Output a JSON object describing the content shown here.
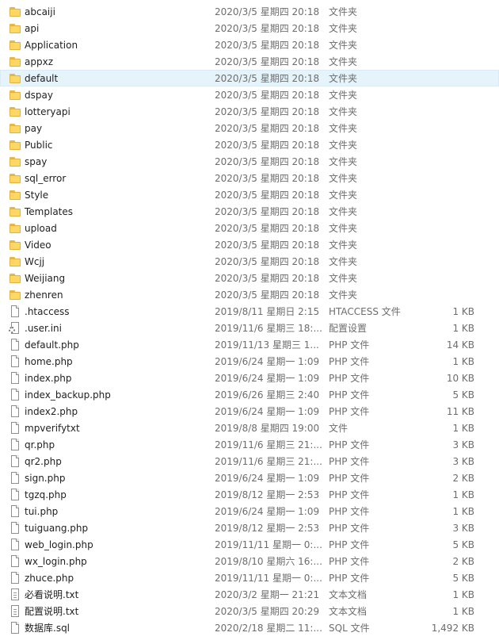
{
  "files": [
    {
      "name": "abcaiji",
      "date": "2020/3/5 星期四 20:18",
      "type": "文件夹",
      "size": "",
      "icon": "folder-icon"
    },
    {
      "name": "api",
      "date": "2020/3/5 星期四 20:18",
      "type": "文件夹",
      "size": "",
      "icon": "folder-icon"
    },
    {
      "name": "Application",
      "date": "2020/3/5 星期四 20:18",
      "type": "文件夹",
      "size": "",
      "icon": "folder-icon"
    },
    {
      "name": "appxz",
      "date": "2020/3/5 星期四 20:18",
      "type": "文件夹",
      "size": "",
      "icon": "folder-icon"
    },
    {
      "name": "default",
      "date": "2020/3/5 星期四 20:18",
      "type": "文件夹",
      "size": "",
      "icon": "folder-icon",
      "selected": true
    },
    {
      "name": "dspay",
      "date": "2020/3/5 星期四 20:18",
      "type": "文件夹",
      "size": "",
      "icon": "folder-icon"
    },
    {
      "name": "lotteryapi",
      "date": "2020/3/5 星期四 20:18",
      "type": "文件夹",
      "size": "",
      "icon": "folder-icon"
    },
    {
      "name": "pay",
      "date": "2020/3/5 星期四 20:18",
      "type": "文件夹",
      "size": "",
      "icon": "folder-icon"
    },
    {
      "name": "Public",
      "date": "2020/3/5 星期四 20:18",
      "type": "文件夹",
      "size": "",
      "icon": "folder-icon"
    },
    {
      "name": "spay",
      "date": "2020/3/5 星期四 20:18",
      "type": "文件夹",
      "size": "",
      "icon": "folder-icon"
    },
    {
      "name": "sql_error",
      "date": "2020/3/5 星期四 20:18",
      "type": "文件夹",
      "size": "",
      "icon": "folder-icon"
    },
    {
      "name": "Style",
      "date": "2020/3/5 星期四 20:18",
      "type": "文件夹",
      "size": "",
      "icon": "folder-icon"
    },
    {
      "name": "Templates",
      "date": "2020/3/5 星期四 20:18",
      "type": "文件夹",
      "size": "",
      "icon": "folder-icon"
    },
    {
      "name": "upload",
      "date": "2020/3/5 星期四 20:18",
      "type": "文件夹",
      "size": "",
      "icon": "folder-icon"
    },
    {
      "name": "Video",
      "date": "2020/3/5 星期四 20:18",
      "type": "文件夹",
      "size": "",
      "icon": "folder-icon"
    },
    {
      "name": "Wcjj",
      "date": "2020/3/5 星期四 20:18",
      "type": "文件夹",
      "size": "",
      "icon": "folder-icon"
    },
    {
      "name": "Weijiang",
      "date": "2020/3/5 星期四 20:18",
      "type": "文件夹",
      "size": "",
      "icon": "folder-icon"
    },
    {
      "name": "zhenren",
      "date": "2020/3/5 星期四 20:18",
      "type": "文件夹",
      "size": "",
      "icon": "folder-icon"
    },
    {
      "name": ".htaccess",
      "date": "2019/8/11 星期日 2:15",
      "type": "HTACCESS 文件",
      "size": "1 KB",
      "icon": "file-icon"
    },
    {
      "name": ".user.ini",
      "date": "2019/11/6 星期三 18:...",
      "type": "配置设置",
      "size": "1 KB",
      "icon": "settings-icon"
    },
    {
      "name": "default.php",
      "date": "2019/11/13 星期三 1...",
      "type": "PHP 文件",
      "size": "14 KB",
      "icon": "file-icon"
    },
    {
      "name": "home.php",
      "date": "2019/6/24 星期一 1:09",
      "type": "PHP 文件",
      "size": "1 KB",
      "icon": "file-icon"
    },
    {
      "name": "index.php",
      "date": "2019/6/24 星期一 1:09",
      "type": "PHP 文件",
      "size": "10 KB",
      "icon": "file-icon"
    },
    {
      "name": "index_backup.php",
      "date": "2019/6/26 星期三 2:40",
      "type": "PHP 文件",
      "size": "5 KB",
      "icon": "file-icon"
    },
    {
      "name": "index2.php",
      "date": "2019/6/24 星期一 1:09",
      "type": "PHP 文件",
      "size": "11 KB",
      "icon": "file-icon"
    },
    {
      "name": "mpverifytxt",
      "date": "2019/8/8 星期四 19:00",
      "type": "文件",
      "size": "1 KB",
      "icon": "file-icon"
    },
    {
      "name": "qr.php",
      "date": "2019/11/6 星期三 21:...",
      "type": "PHP 文件",
      "size": "3 KB",
      "icon": "file-icon"
    },
    {
      "name": "qr2.php",
      "date": "2019/11/6 星期三 21:...",
      "type": "PHP 文件",
      "size": "3 KB",
      "icon": "file-icon"
    },
    {
      "name": "sign.php",
      "date": "2019/6/24 星期一 1:09",
      "type": "PHP 文件",
      "size": "2 KB",
      "icon": "file-icon"
    },
    {
      "name": "tgzq.php",
      "date": "2019/8/12 星期一 2:53",
      "type": "PHP 文件",
      "size": "1 KB",
      "icon": "file-icon"
    },
    {
      "name": "tui.php",
      "date": "2019/6/24 星期一 1:09",
      "type": "PHP 文件",
      "size": "1 KB",
      "icon": "file-icon"
    },
    {
      "name": "tuiguang.php",
      "date": "2019/8/12 星期一 2:53",
      "type": "PHP 文件",
      "size": "3 KB",
      "icon": "file-icon"
    },
    {
      "name": "web_login.php",
      "date": "2019/11/11 星期一 0:...",
      "type": "PHP 文件",
      "size": "5 KB",
      "icon": "file-icon"
    },
    {
      "name": "wx_login.php",
      "date": "2019/8/10 星期六 16:...",
      "type": "PHP 文件",
      "size": "2 KB",
      "icon": "file-icon"
    },
    {
      "name": "zhuce.php",
      "date": "2019/11/11 星期一 0:...",
      "type": "PHP 文件",
      "size": "5 KB",
      "icon": "file-icon"
    },
    {
      "name": "必看说明.txt",
      "date": "2020/3/2 星期一 21:21",
      "type": "文本文档",
      "size": "1 KB",
      "icon": "text-icon"
    },
    {
      "name": "配置说明.txt",
      "date": "2020/3/5 星期四 20:29",
      "type": "文本文档",
      "size": "1 KB",
      "icon": "text-icon"
    },
    {
      "name": "数据库.sql",
      "date": "2020/2/18 星期二 11:...",
      "type": "SQL 文件",
      "size": "1,492 KB",
      "icon": "file-icon"
    }
  ]
}
